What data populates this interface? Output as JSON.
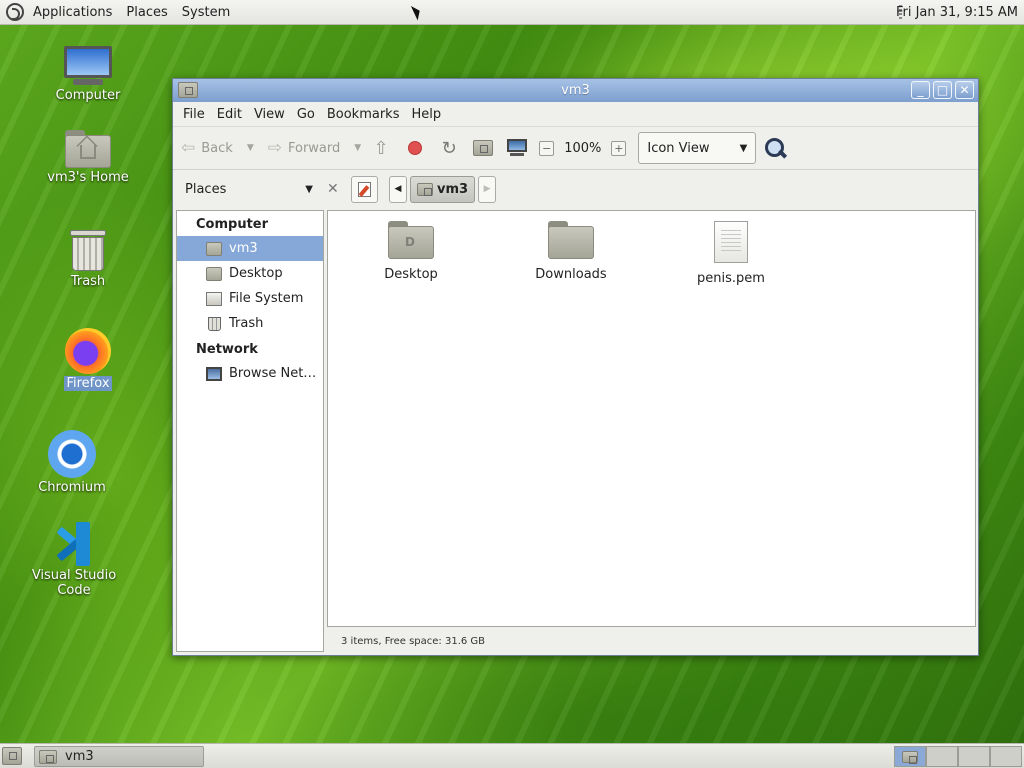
{
  "top_panel": {
    "menus": [
      "Applications",
      "Places",
      "System"
    ],
    "clock": "Fri Jan 31,  9:15 AM"
  },
  "desktop_icons": [
    {
      "label": "Computer",
      "icon": "computer-icon"
    },
    {
      "label": "vm3's Home",
      "icon": "home-folder-icon"
    },
    {
      "label": "Trash",
      "icon": "trash-icon"
    },
    {
      "label": "Firefox",
      "icon": "firefox-icon",
      "selected": true
    },
    {
      "label": "Chromium",
      "icon": "chromium-icon"
    },
    {
      "label": "Visual Studio Code",
      "icon": "vscode-icon"
    }
  ],
  "window": {
    "title": "vm3",
    "menubar": [
      "File",
      "Edit",
      "View",
      "Go",
      "Bookmarks",
      "Help"
    ],
    "toolbar": {
      "back_label": "Back",
      "forward_label": "Forward",
      "zoom": "100%",
      "view_mode": "Icon View"
    },
    "location": {
      "pane_label": "Places",
      "crumb": "vm3"
    },
    "sidebar": {
      "sections": [
        {
          "heading": "Computer",
          "items": [
            {
              "label": "vm3",
              "icon": "home-folder-icon",
              "active": true
            },
            {
              "label": "Desktop",
              "icon": "folder-icon"
            },
            {
              "label": "File System",
              "icon": "drive-icon"
            },
            {
              "label": "Trash",
              "icon": "trash-icon"
            }
          ]
        },
        {
          "heading": "Network",
          "items": [
            {
              "label": "Browse Net…",
              "icon": "network-icon"
            }
          ]
        }
      ]
    },
    "files": [
      {
        "name": "Desktop",
        "icon": "desktop-folder-icon"
      },
      {
        "name": "Downloads",
        "icon": "folder-icon"
      },
      {
        "name": "penis.pem",
        "icon": "text-file-icon"
      }
    ],
    "status": "3 items, Free space: 31.6 GB"
  },
  "taskbar": {
    "task_label": "vm3",
    "workspace_count": 4,
    "active_workspace": 1
  },
  "colors": {
    "titlebar": "#7d9fcf",
    "selection": "#86a8d8"
  }
}
